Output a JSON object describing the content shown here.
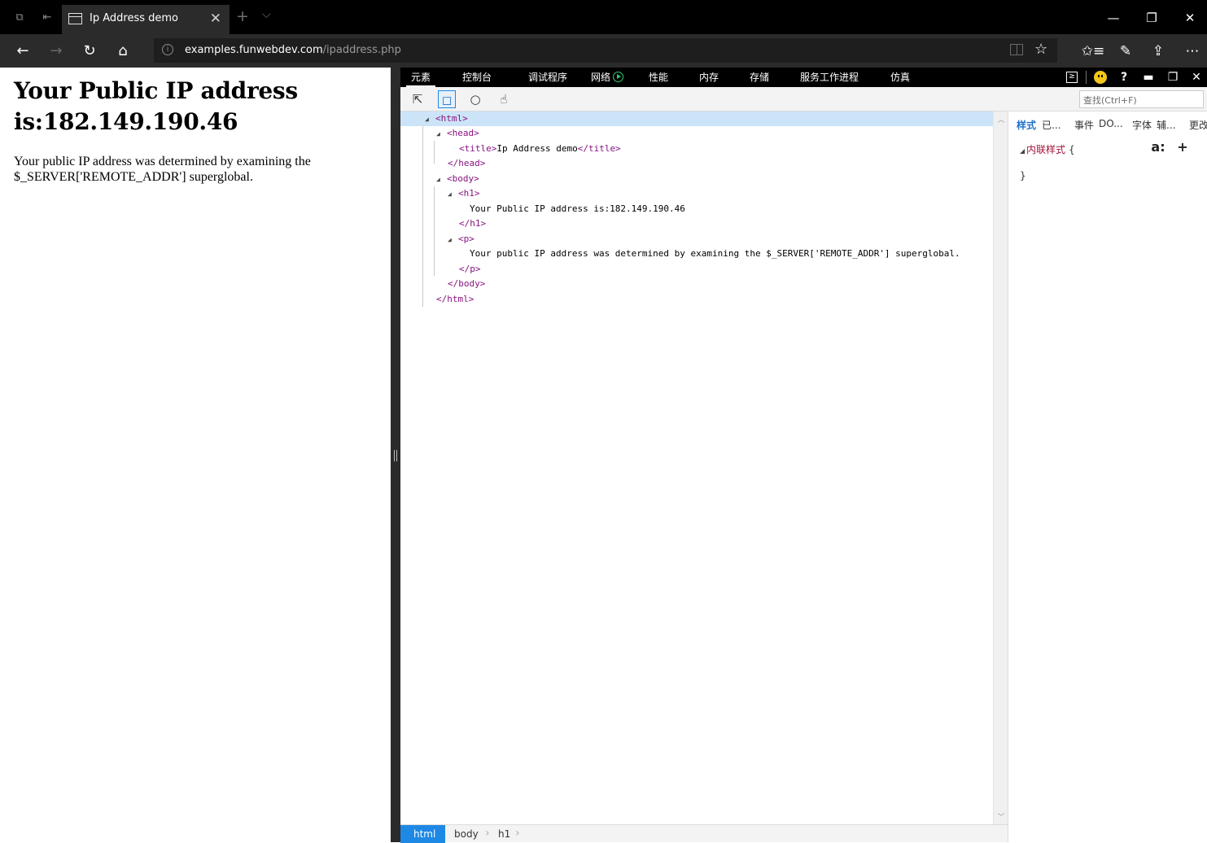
{
  "browser": {
    "tab_title": "Ip Address demo",
    "tab_close": "✕",
    "new_tab": "+",
    "tab_list": "⌵",
    "window_controls": {
      "minimize": "—",
      "restore": "❐",
      "close": "✕"
    },
    "url_host": "examples.funwebdev.com",
    "url_path": "/ipaddress.php",
    "nav": {
      "back": "←",
      "forward": "→",
      "refresh": "↻",
      "home": "⌂"
    },
    "toolbar_right": {
      "favorites_icon": "✩≡",
      "pen_icon": "✎",
      "share_icon": "⇪",
      "more_icon": "⋯"
    }
  },
  "page": {
    "heading": "Your Public IP address is:182.149.190.46",
    "paragraph": "Your public IP address was determined by examining the $_SERVER['REMOTE_ADDR'] superglobal."
  },
  "devtools": {
    "tabs": [
      "元素",
      "控制台",
      "调试程序",
      "网络",
      "性能",
      "内存",
      "存储",
      "服务工作进程",
      "仿真"
    ],
    "right_icons": {
      "console": "≥",
      "help": "?",
      "dock": "▬",
      "undock": "❐",
      "close": "✕"
    },
    "search_placeholder": "查找(Ctrl+F)",
    "dom": {
      "html_open": "<html>",
      "head_open": "<head>",
      "title_open": "<title>",
      "title_text": "Ip Address demo",
      "title_close": "</title>",
      "head_close": "</head>",
      "body_open": "<body>",
      "h1_open": "<h1>",
      "h1_text": "Your Public IP address is:182.149.190.46",
      "h1_close": "</h1>",
      "p_open": "<p>",
      "p_text": "Your public IP address was determined by examining the $_SERVER['REMOTE_ADDR'] superglobal.",
      "p_close": "</p>",
      "body_close": "</body>",
      "html_close": "</html>"
    },
    "breadcrumbs": [
      "html",
      "body",
      "h1"
    ],
    "styles": {
      "tabs": [
        "样式",
        "已...",
        "事件",
        "DO...",
        "字体",
        "辅...",
        "更改"
      ],
      "rule_label": "内联样式",
      "rule_open": "{",
      "rule_close": "}",
      "pseudo_button": "a:",
      "add_button": "+"
    }
  },
  "colors": {
    "accent": "#1e88e5",
    "network_active": "#2fcc71",
    "tag": "#881280"
  }
}
